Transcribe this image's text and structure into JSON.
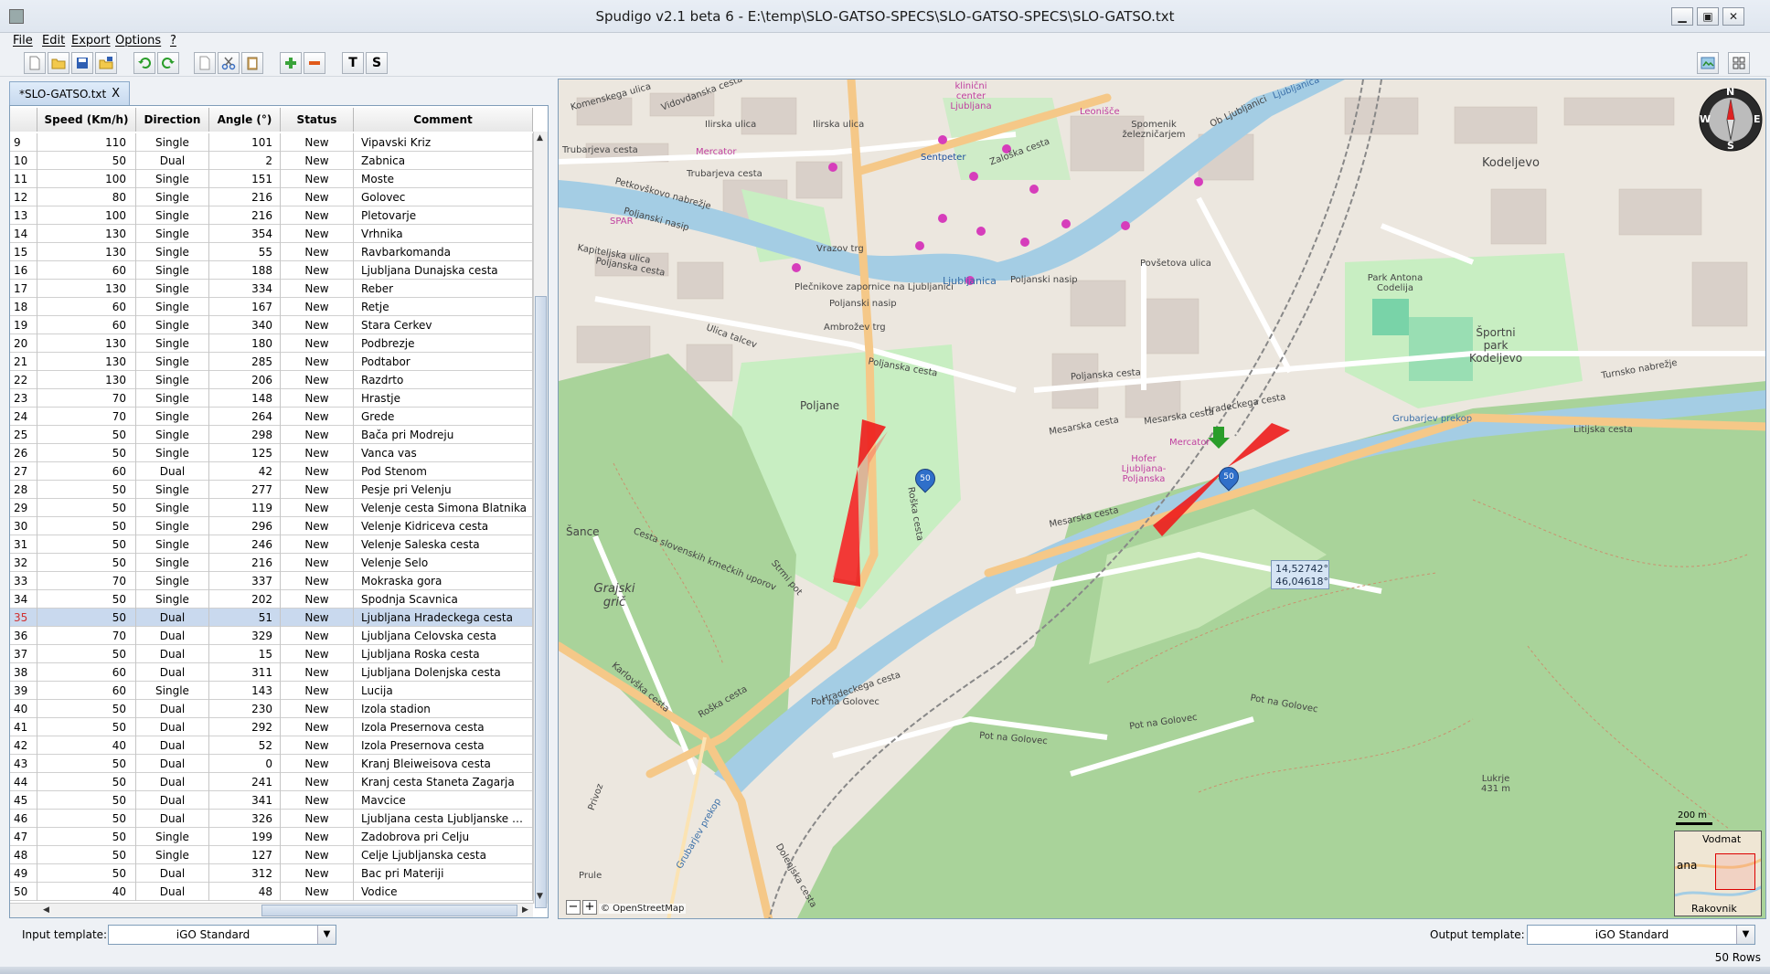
{
  "window": {
    "title": "Spudigo v2.1 beta 6 - E:\\temp\\SLO-GATSO-SPECS\\SLO-GATSO-SPECS\\SLO-GATSO.txt",
    "min": "▁",
    "max": "▣",
    "close": "✕"
  },
  "menu": [
    "File",
    "Edit",
    "Export",
    "Options",
    "?"
  ],
  "toolbar": {
    "text_button": "T",
    "s_button": "S"
  },
  "tab": {
    "label": "*SLO-GATSO.txt",
    "close": "X"
  },
  "table": {
    "headers": [
      "",
      "Speed (Km/h)",
      "Direction",
      "Angle (°)",
      "Status",
      "Comment"
    ],
    "selected_row": 35,
    "rows": [
      [
        9,
        110,
        "Single",
        101,
        "New",
        "Vipavski Kriz"
      ],
      [
        10,
        50,
        "Dual",
        2,
        "New",
        "Zabnica"
      ],
      [
        11,
        100,
        "Single",
        151,
        "New",
        "Moste"
      ],
      [
        12,
        80,
        "Single",
        216,
        "New",
        "Golovec"
      ],
      [
        13,
        100,
        "Single",
        216,
        "New",
        "Pletovarje"
      ],
      [
        14,
        130,
        "Single",
        354,
        "New",
        "Vrhnika"
      ],
      [
        15,
        130,
        "Single",
        55,
        "New",
        "Ravbarkomanda"
      ],
      [
        16,
        60,
        "Single",
        188,
        "New",
        "Ljubljana Dunajska cesta"
      ],
      [
        17,
        130,
        "Single",
        334,
        "New",
        "Reber"
      ],
      [
        18,
        60,
        "Single",
        167,
        "New",
        "Retje"
      ],
      [
        19,
        60,
        "Single",
        340,
        "New",
        "Stara Cerkev"
      ],
      [
        20,
        130,
        "Single",
        180,
        "New",
        "Podbrezje"
      ],
      [
        21,
        130,
        "Single",
        285,
        "New",
        "Podtabor"
      ],
      [
        22,
        130,
        "Single",
        206,
        "New",
        "Razdrto"
      ],
      [
        23,
        70,
        "Single",
        148,
        "New",
        "Hrastje"
      ],
      [
        24,
        70,
        "Single",
        264,
        "New",
        "Grede"
      ],
      [
        25,
        50,
        "Single",
        298,
        "New",
        "Bača pri Modreju"
      ],
      [
        26,
        50,
        "Single",
        125,
        "New",
        "Vanca vas"
      ],
      [
        27,
        60,
        "Dual",
        42,
        "New",
        "Pod Stenom"
      ],
      [
        28,
        50,
        "Single",
        277,
        "New",
        "Pesje pri Velenju"
      ],
      [
        29,
        50,
        "Single",
        119,
        "New",
        "Velenje cesta Simona Blatnika"
      ],
      [
        30,
        50,
        "Single",
        296,
        "New",
        "Velenje Kidriceva cesta"
      ],
      [
        31,
        50,
        "Single",
        246,
        "New",
        "Velenje Saleska cesta"
      ],
      [
        32,
        50,
        "Single",
        216,
        "New",
        "Velenje Selo"
      ],
      [
        33,
        70,
        "Single",
        337,
        "New",
        "Mokraska gora"
      ],
      [
        34,
        50,
        "Single",
        202,
        "New",
        "Spodnja Scavnica"
      ],
      [
        35,
        50,
        "Dual",
        51,
        "New",
        "Ljubljana Hradeckega cesta"
      ],
      [
        36,
        70,
        "Dual",
        329,
        "New",
        "Ljubljana Celovska cesta"
      ],
      [
        37,
        50,
        "Dual",
        15,
        "New",
        "Ljubljana Roska cesta"
      ],
      [
        38,
        60,
        "Dual",
        311,
        "New",
        "Ljubljana Dolenjska cesta"
      ],
      [
        39,
        60,
        "Single",
        143,
        "New",
        "Lucija"
      ],
      [
        40,
        50,
        "Dual",
        230,
        "New",
        "Izola stadion"
      ],
      [
        41,
        50,
        "Dual",
        292,
        "New",
        "Izola Presernova cesta"
      ],
      [
        42,
        40,
        "Dual",
        52,
        "New",
        "Izola Presernova cesta"
      ],
      [
        43,
        50,
        "Dual",
        0,
        "New",
        "Kranj Bleiweisova cesta"
      ],
      [
        44,
        50,
        "Dual",
        241,
        "New",
        "Kranj cesta Staneta Zagarja"
      ],
      [
        45,
        50,
        "Dual",
        341,
        "New",
        "Mavcice"
      ],
      [
        46,
        50,
        "Dual",
        326,
        "New",
        "Ljubljana cesta Ljubljanske bri..."
      ],
      [
        47,
        50,
        "Single",
        199,
        "New",
        "Zadobrova pri Celju"
      ],
      [
        48,
        50,
        "Single",
        127,
        "New",
        "Celje Ljubljanska cesta"
      ],
      [
        49,
        50,
        "Dual",
        312,
        "New",
        "Bac pri Materiji"
      ],
      [
        50,
        40,
        "Dual",
        48,
        "New",
        "Vodice"
      ]
    ]
  },
  "map": {
    "labels": [
      {
        "text": "Komenskega ulica",
        "id": "komenskega"
      },
      {
        "text": "Vidovdanska cesta",
        "id": "vidovdanska"
      },
      {
        "text": "Ilirska ulica",
        "id": "ilirska1"
      },
      {
        "text": "Ilirska ulica",
        "id": "ilirska2"
      },
      {
        "text": "Trubarjeva cesta",
        "id": "trubarjeva1"
      },
      {
        "text": "Mercator",
        "id": "mercator1"
      },
      {
        "text": "Trubarjeva cesta",
        "id": "trubarjeva2"
      },
      {
        "text": "Petkovškovo nabrežje",
        "id": "petkovskovo"
      },
      {
        "text": "Poljanski nasip",
        "id": "poljanski1"
      },
      {
        "text": "SPAR",
        "id": "spar"
      },
      {
        "text": "Kapiteljska ulica",
        "id": "kapiteljska"
      },
      {
        "text": "Poljanska cesta",
        "id": "poljanska1"
      },
      {
        "text": "Vrazov trg",
        "id": "vrazov"
      },
      {
        "text": "Plečnikove zapornice na Ljubljanici",
        "id": "plecnik"
      },
      {
        "text": "Poljanski nasip",
        "id": "poljanski2"
      },
      {
        "text": "Ambrožev trg",
        "id": "ambrozev"
      },
      {
        "text": "Ulica talcev",
        "id": "talcev"
      },
      {
        "text": "Poljanska cesta",
        "id": "poljanska2"
      },
      {
        "text": "Poljanska cesta",
        "id": "poljanska3"
      },
      {
        "text": "Poljane",
        "id": "poljane"
      },
      {
        "text": "Sentpeter",
        "id": "sentpeter"
      },
      {
        "text": "Zaloška cesta",
        "id": "zaloska"
      },
      {
        "text": "klinični center Ljubljana",
        "id": "klinicni"
      },
      {
        "text": "Leonišče",
        "id": "leonisce"
      },
      {
        "text": "Spomenik železničarjem",
        "id": "spomenik"
      },
      {
        "text": "Ob Ljubljanici",
        "id": "obljubljanici"
      },
      {
        "text": "Ljubljanica",
        "id": "ljubljanica1"
      },
      {
        "text": "Ljubljanica",
        "id": "ljubljanica2"
      },
      {
        "text": "Povšetova ulica",
        "id": "povsetova"
      },
      {
        "text": "Poljanski nasip",
        "id": "poljanski3"
      },
      {
        "text": "Mesarska cesta",
        "id": "mesarska1"
      },
      {
        "text": "Mesarska cesta",
        "id": "mesarska2"
      },
      {
        "text": "Mesarska cesta",
        "id": "mesarska3"
      },
      {
        "text": "Mercator",
        "id": "mercator2"
      },
      {
        "text": "Hofer Ljubljana-Poljanska",
        "id": "hofer"
      },
      {
        "text": "Hradeckega cesta",
        "id": "hradeckega1"
      },
      {
        "text": "Kodeljevo",
        "id": "kodeljevo"
      },
      {
        "text": "Park Antona Codelija",
        "id": "park"
      },
      {
        "text": "Športni park Kodeljevo",
        "id": "sportni"
      },
      {
        "text": "Turnsko nabrežje",
        "id": "turnsko"
      },
      {
        "text": "Grubarjev prekop",
        "id": "grubarjev1"
      },
      {
        "text": "Litijska cesta",
        "id": "litijska"
      },
      {
        "text": "Šance",
        "id": "sance"
      },
      {
        "text": "Grajski grič",
        "id": "grajski"
      },
      {
        "text": "Cesta slovenskih kmečkih uporov",
        "id": "kmeckih"
      },
      {
        "text": "Strmi pot",
        "id": "strmi"
      },
      {
        "text": "Hradeckega cesta",
        "id": "hradeckega2"
      },
      {
        "text": "Pot na Golovec",
        "id": "golovec1"
      },
      {
        "text": "Pot na Golovec",
        "id": "golovec2"
      },
      {
        "text": "Pot na Golovec",
        "id": "golovec3"
      },
      {
        "text": "Pot na Golovec",
        "id": "golovec4"
      },
      {
        "text": "Roška cesta",
        "id": "roska1"
      },
      {
        "text": "Roška cesta",
        "id": "roska2"
      },
      {
        "text": "Karlovška cesta",
        "id": "karlovska"
      },
      {
        "text": "Dolenjska cesta",
        "id": "dolenjska"
      },
      {
        "text": "Grubarjev prekop",
        "id": "grubarjev2"
      },
      {
        "text": "Lukrje 431 m",
        "id": "lukrje"
      },
      {
        "text": "Privoz",
        "id": "privoz"
      },
      {
        "text": "Prule",
        "id": "prule"
      }
    ],
    "markers": [
      {
        "id": "camera-roska",
        "speed": "50"
      },
      {
        "id": "camera-hradeckega",
        "speed": "50"
      }
    ],
    "coord_tip": {
      "line1": "14,52742°",
      "line2": "46,04618°"
    },
    "attribution": "© OpenStreetMap",
    "zoom_out": "−",
    "zoom_in": "+",
    "scale": "200 m",
    "minimap_labels": {
      "top": "Vodmat",
      "left": "ana",
      "bottom": "Rakovnik"
    },
    "compass": {
      "n": "N",
      "s": "S",
      "e": "E",
      "w": "W"
    },
    "colors": {
      "park": "#c8eec2",
      "forest": "#a9d39a",
      "water": "#a4cde4",
      "major_road": "#f5c888",
      "red_cone": "#ee1c1c",
      "marker_blue": "#2f6fc9",
      "marker_green": "#2a9d2a"
    }
  },
  "bottom": {
    "input_label": "Input template:",
    "input_value": "iGO Standard",
    "output_label": "Output template:",
    "output_value": "iGO Standard",
    "row_count": "50 Rows"
  }
}
